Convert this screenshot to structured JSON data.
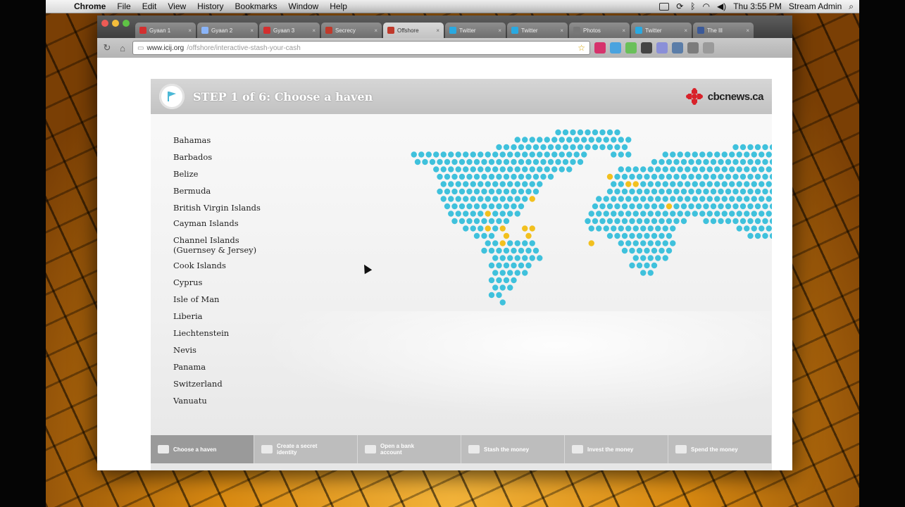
{
  "menubar": {
    "app": "Chrome",
    "items": [
      "File",
      "Edit",
      "View",
      "History",
      "Bookmarks",
      "Window",
      "Help"
    ],
    "clock": "Thu 3:55 PM",
    "user": "Stream Admin"
  },
  "tabs": [
    {
      "label": "Gyaan 1",
      "favicon": "#d32f2f",
      "active": false
    },
    {
      "label": "Gyaan 2",
      "favicon": "#8ab4f8",
      "active": false
    },
    {
      "label": "Gyaan 3",
      "favicon": "#d32f2f",
      "active": false
    },
    {
      "label": "Secrecy",
      "favicon": "#c0392b",
      "active": false
    },
    {
      "label": "Offshore",
      "favicon": "#c0392b",
      "active": true
    },
    {
      "label": "Twitter",
      "favicon": "#29a9e1",
      "active": false
    },
    {
      "label": "Twitter",
      "favicon": "#29a9e1",
      "active": false
    },
    {
      "label": "Photos",
      "favicon": "#777777",
      "active": false
    },
    {
      "label": "Twitter",
      "favicon": "#29a9e1",
      "active": false
    },
    {
      "label": "The Ill",
      "favicon": "#3b5998",
      "active": false
    }
  ],
  "address": {
    "host": "www.icij.org",
    "path": "/offshore/interactive-stash-your-cash"
  },
  "panel": {
    "step_title": "STEP 1 of 6: Choose a haven",
    "logo_text": "cbcnews.ca"
  },
  "havens": [
    "Bahamas",
    "Barbados",
    "Belize",
    "Bermuda",
    "British Virgin Islands",
    "Cayman Islands",
    "Channel Islands (Guernsey & Jersey)",
    "Cook Islands",
    "Cyprus",
    "Isle of Man",
    "Liberia",
    "Liechtenstein",
    "Nevis",
    "Panama",
    "Switzerland",
    "Vanuatu"
  ],
  "steps": [
    {
      "label": "Choose a haven",
      "active": true
    },
    {
      "label": "Create a secret identity",
      "active": false
    },
    {
      "label": "Open a bank account",
      "active": false
    },
    {
      "label": "Stash the money",
      "active": false
    },
    {
      "label": "Invest the money",
      "active": false
    },
    {
      "label": "Spend the money",
      "active": false
    }
  ],
  "colors": {
    "land_dot": "#3fc1dc",
    "haven_dot": "#f2c01e",
    "logo_red": "#d8222a"
  }
}
